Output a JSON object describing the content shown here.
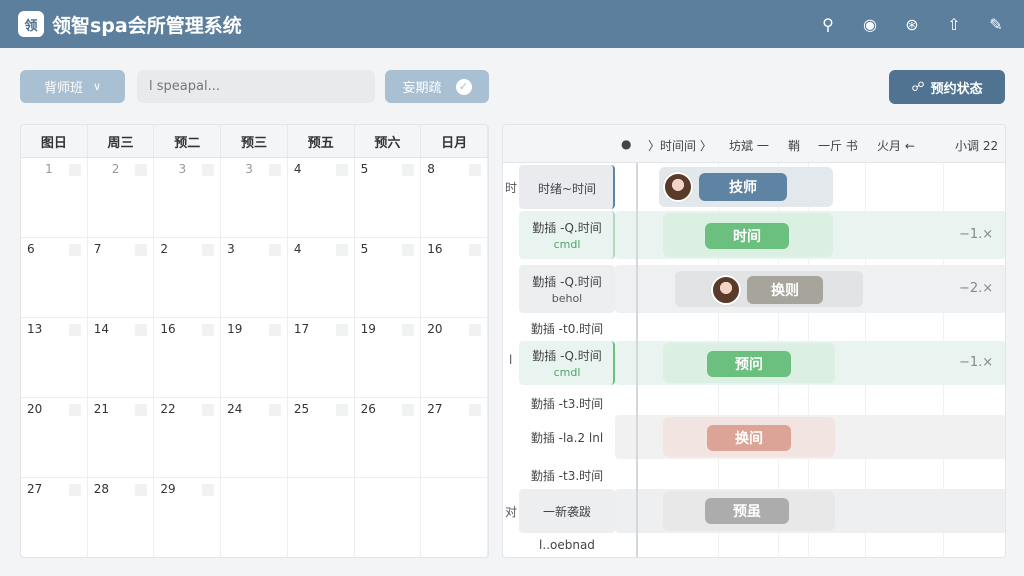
{
  "app": {
    "logo_text": "领",
    "title": "领智spa会所管理系统"
  },
  "header_icons": [
    "search-icon",
    "notification-icon",
    "wifi-icon",
    "share-icon",
    "edit-icon"
  ],
  "toolbar": {
    "class_select": "背师班",
    "search_placeholder": "l speapal...",
    "new_button": "妄期疏",
    "status_button": "预约状态"
  },
  "calendar": {
    "weekdays": [
      "图日",
      "周三",
      "预二",
      "预三",
      "预五",
      "预六",
      "日月"
    ],
    "weeks": [
      [
        "1",
        "2",
        "3",
        "3",
        "4",
        "5",
        "8"
      ],
      [
        "6",
        "7",
        "2",
        "3",
        "4",
        "5",
        "16"
      ],
      [
        "13",
        "14",
        "16",
        "19",
        "17",
        "19",
        "20"
      ],
      [
        "20",
        "21",
        "22",
        "24",
        "25",
        "26",
        "27"
      ],
      [
        "27",
        "28",
        "29",
        "",
        "",
        "",
        ""
      ]
    ]
  },
  "schedule": {
    "header": {
      "dot": "●",
      "col1": "〉时间间 〉",
      "col2": "坊斌 一",
      "col3": "鞘",
      "col4": "一斤 书",
      "col5": "火月 ←",
      "col6": "小调 22"
    },
    "rows": [
      {
        "label": "时绪~时间",
        "sub": "",
        "left_mark": "时"
      },
      {
        "label": "勤插 -Q.时间",
        "sub": "cmdl",
        "duration": "−1.×"
      },
      {
        "label": "勤插 -Q.时间",
        "sub": "behol",
        "duration": "−2.×"
      },
      {
        "label": "勤插 -t0.时间",
        "sub": ""
      },
      {
        "label": "勤插 -Q.时间",
        "sub": "cmdl",
        "left_mark": "l",
        "duration": "−1.×"
      },
      {
        "label": "勤插 -t3.时间",
        "sub": ""
      },
      {
        "label": "勤插 -la.2 lnl",
        "sub": ""
      },
      {
        "label": "勤插 -t3.时间",
        "sub": ""
      },
      {
        "label": "一新袭跋",
        "sub": "",
        "left_mark": "对"
      },
      {
        "label": "l..oebnad",
        "sub": ""
      }
    ],
    "events": [
      {
        "label": "技师",
        "color": "#5f84a3"
      },
      {
        "label": "时间",
        "color": "#6cc07f"
      },
      {
        "label": "换则",
        "color": "#a7a49c"
      },
      {
        "label": "预问",
        "color": "#6cc07f"
      },
      {
        "label": "换间",
        "color": "#dba497"
      },
      {
        "label": "预虽",
        "color": "#acacac"
      }
    ]
  }
}
